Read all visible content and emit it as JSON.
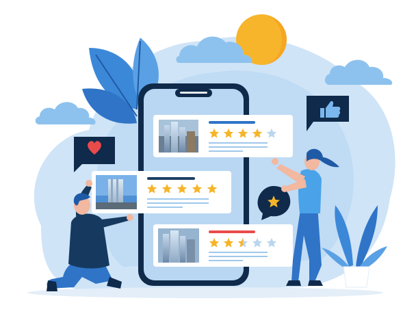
{
  "illustration": {
    "colors": {
      "background": "#ffffff",
      "blob_light": "#cfe4f7",
      "blob_mid": "#a9cdf0",
      "phone_frame": "#0f2a4a",
      "phone_screen": "#b9d7f2",
      "card": "#ffffff",
      "star_gold": "#f5b529",
      "star_empty": "#b9d6ee",
      "accent_blue": "#2f74c7",
      "accent_red": "#e94b4b",
      "sun": "#f7b52c",
      "leaf": "#3c88d8",
      "text_line": "#9ec8ea"
    },
    "cards": [
      {
        "name": "top",
        "rating": 4,
        "accent": "blue"
      },
      {
        "name": "middle",
        "rating": 5,
        "accent": "navy"
      },
      {
        "name": "bottom",
        "rating": 2.5,
        "accent": "red"
      }
    ],
    "icons": [
      "heart-icon",
      "thumbs-up-icon",
      "star-badge-icon",
      "sun-icon",
      "cloud-icon",
      "plant-icon"
    ]
  }
}
